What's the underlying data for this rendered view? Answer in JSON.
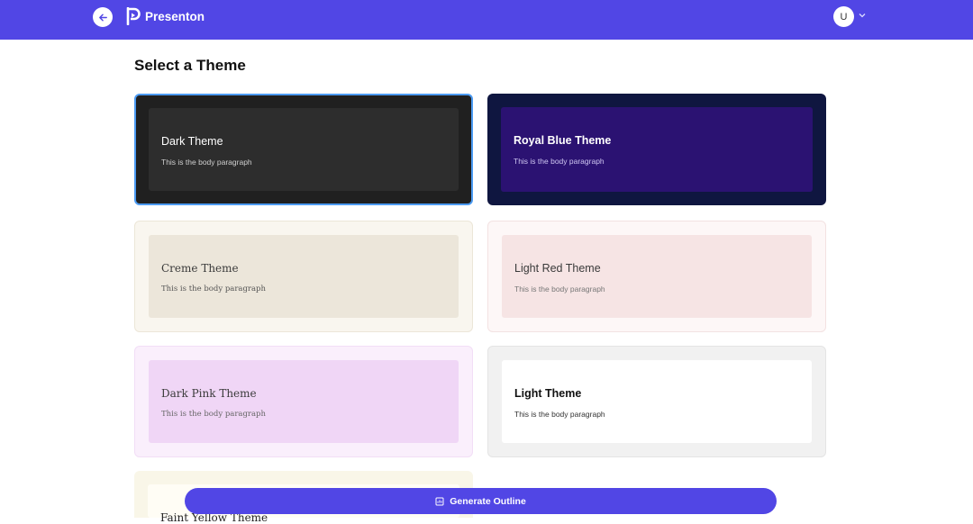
{
  "header": {
    "app_name": "Presenton",
    "avatar_initial": "U",
    "accent_color": "#5146e5"
  },
  "page": {
    "title": "Select a Theme"
  },
  "themes": [
    {
      "name": "Dark Theme",
      "body": "This is the body paragraph",
      "selected": true
    },
    {
      "name": "Royal Blue Theme",
      "body": "This is the body paragraph",
      "selected": false
    },
    {
      "name": "Creme Theme",
      "body": "This is the body paragraph",
      "selected": false
    },
    {
      "name": "Light Red Theme",
      "body": "This is the body paragraph",
      "selected": false
    },
    {
      "name": "Dark Pink Theme",
      "body": "This is the body paragraph",
      "selected": false
    },
    {
      "name": "Light Theme",
      "body": "This is the body paragraph",
      "selected": false
    },
    {
      "name": "Faint Yellow Theme",
      "body": "",
      "selected": false
    }
  ],
  "footer": {
    "generate_label": "Generate Outline"
  }
}
